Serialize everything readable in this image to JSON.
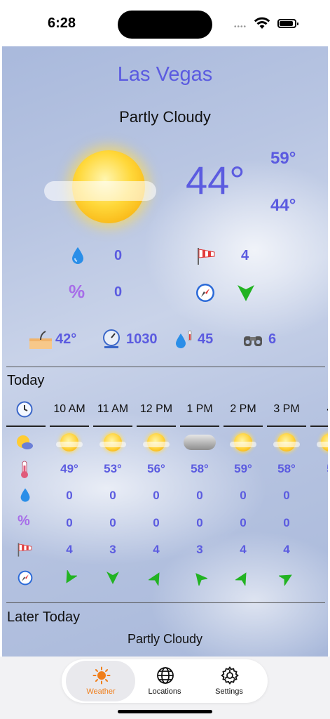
{
  "status": {
    "time": "6:28",
    "dots": "••••"
  },
  "header": {
    "city": "Las Vegas",
    "condition": "Partly Cloudy"
  },
  "current": {
    "temp": "44°",
    "high": "59°",
    "low": "44°"
  },
  "details": {
    "precip": "0",
    "wind_speed": "4",
    "humidity_chance": "0",
    "feels_like": "42°",
    "pressure": "1030",
    "dew_point": "45",
    "visibility": "6"
  },
  "today": {
    "title": "Today",
    "hours": [
      "10 AM",
      "11 AM",
      "12 PM",
      "1 PM",
      "2 PM",
      "3 PM",
      "4"
    ],
    "conditions": [
      "sun",
      "sun",
      "sun",
      "cloud",
      "sun",
      "sun",
      "sun"
    ],
    "temps": [
      "49°",
      "53°",
      "56°",
      "58°",
      "59°",
      "58°",
      "5"
    ],
    "precip": [
      "0",
      "0",
      "0",
      "0",
      "0",
      "0"
    ],
    "chance": [
      "0",
      "0",
      "0",
      "0",
      "0",
      "0"
    ],
    "wind": [
      "4",
      "3",
      "4",
      "3",
      "4",
      "4"
    ],
    "wind_dir_deg": [
      210,
      180,
      30,
      320,
      30,
      60
    ]
  },
  "later": {
    "title": "Later Today",
    "condition": "Partly Cloudy"
  },
  "tabs": [
    {
      "label": "Weather",
      "icon": "sun-icon",
      "active": true
    },
    {
      "label": "Locations",
      "icon": "globe-icon",
      "active": false
    },
    {
      "label": "Settings",
      "icon": "gear-icon",
      "active": false
    }
  ],
  "colors": {
    "accent": "#5b5be0",
    "active_tab": "#f07e1a",
    "wind_arrow": "#22b322"
  }
}
